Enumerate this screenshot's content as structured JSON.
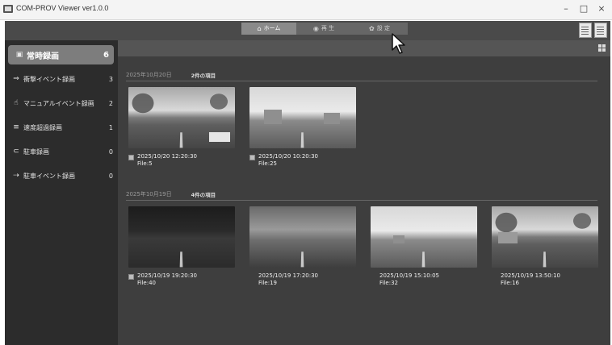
{
  "window": {
    "title": "COM-PROV Viewer ver1.0.0",
    "minimize": "–",
    "maximize": "□",
    "close": "×"
  },
  "topbar": {
    "tabs": [
      {
        "label": "ホーム",
        "icon": "home-icon",
        "glyph": "⌂",
        "active": true
      },
      {
        "label": "再 生",
        "icon": "play-circle-icon",
        "glyph": "◉",
        "active": false
      },
      {
        "label": "設 定",
        "icon": "gear-icon",
        "glyph": "✿",
        "active": false
      }
    ]
  },
  "sidebar": {
    "items": [
      {
        "label": "常時録画",
        "count": "6",
        "icon": "video-camera-icon",
        "glyph": "▣",
        "selected": true
      },
      {
        "label": "衝撃イベント録画",
        "count": "3",
        "icon": "car-crash-icon",
        "glyph": "⇒",
        "selected": false
      },
      {
        "label": "マニュアルイベント録画",
        "count": "2",
        "icon": "hand-press-icon",
        "glyph": "☝",
        "selected": false
      },
      {
        "label": "速度超過録画",
        "count": "1",
        "icon": "speeding-car-icon",
        "glyph": "≡",
        "selected": false
      },
      {
        "label": "駐車録画",
        "count": "0",
        "icon": "parked-car-icon",
        "glyph": "⊂",
        "selected": false
      },
      {
        "label": "駐車イベント録画",
        "count": "0",
        "icon": "parking-event-icon",
        "glyph": "⇢",
        "selected": false
      }
    ]
  },
  "groups": [
    {
      "date": "2025年10月20日",
      "count_label": "2件の項目",
      "items": [
        {
          "datetime": "2025/10/20 12:20:30",
          "file": "File:5",
          "scene": "day"
        },
        {
          "datetime": "2025/10/20 10:20:30",
          "file": "File:25",
          "scene": "sky"
        }
      ]
    },
    {
      "date": "2025年10月19日",
      "count_label": "4件の項目",
      "items": [
        {
          "datetime": "2025/10/19 19:20:30",
          "file": "File:40",
          "scene": "night"
        },
        {
          "datetime": "2025/10/19 17:20:30",
          "file": "File:19",
          "scene": "dusk"
        },
        {
          "datetime": "2025/10/19 15:10:05",
          "file": "File:32",
          "scene": "sky"
        },
        {
          "datetime": "2025/10/19 13:50:10",
          "file": "File:16",
          "scene": "day"
        }
      ]
    }
  ]
}
